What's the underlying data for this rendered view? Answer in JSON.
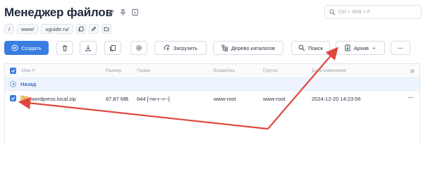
{
  "page": {
    "title": "Менеджер файлов"
  },
  "search": {
    "placeholder": "Ctrl + Shift + F"
  },
  "breadcrumb": {
    "root": "/",
    "items": [
      "www/",
      "uguide.ru/"
    ]
  },
  "toolbar": {
    "create_label": "Создать",
    "upload_label": "Загрузить",
    "tree_label": "Дерево каталогов",
    "search_label": "Поиск",
    "archive_label": "Архив",
    "more_label": "···"
  },
  "table": {
    "columns": {
      "name": "Имя",
      "size": "Размер",
      "perms": "Права",
      "owner": "Владелец",
      "group": "Группа",
      "modified": "Дата изменения"
    },
    "back_label": "Назад",
    "rows": [
      {
        "name": "wordpress.local.zip",
        "size": "67.87 MB",
        "perms": "644 [-rw-r--r--]",
        "owner": "www-root",
        "group": "www-root",
        "modified": "2024-12-20 14:23:56",
        "menu": "···",
        "selected": true
      }
    ]
  },
  "colors": {
    "accent": "#3a7de0",
    "annotation": "#e0483f",
    "back_row": "#eef4fd"
  }
}
